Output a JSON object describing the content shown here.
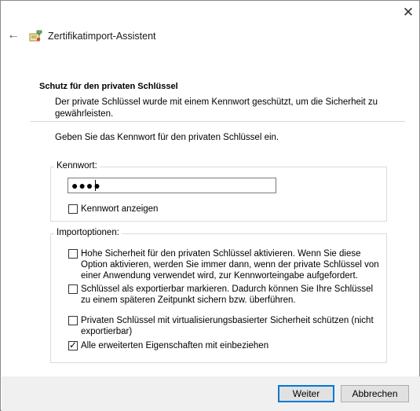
{
  "window": {
    "title": "Zertifikatimport-Assistent",
    "close_glyph": "✕",
    "back_glyph": "←"
  },
  "section": {
    "heading": "Schutz für den privaten Schlüssel",
    "description": "Der private Schlüssel wurde mit einem Kennwort geschützt, um die Sicherheit zu gewährleisten."
  },
  "prompt": "Geben Sie das Kennwort für den privaten Schlüssel ein.",
  "password_group": {
    "label": "Kennwort:",
    "masked_value": "●●●●",
    "show_password_label": "Kennwort anzeigen",
    "show_password_checked": false
  },
  "import_options": {
    "label": "Importoptionen:",
    "options": [
      {
        "label": "Hohe Sicherheit für den privaten Schlüssel aktivieren. Wenn Sie diese Option aktivieren, werden Sie immer dann, wenn der private Schlüssel von einer Anwendung verwendet wird, zur Kennworteingabe aufgefordert.",
        "checked": false
      },
      {
        "label": "Schlüssel als exportierbar markieren. Dadurch können Sie Ihre Schlüssel zu einem späteren Zeitpunkt sichern bzw. überführen.",
        "checked": false
      },
      {
        "label": "Privaten Schlüssel mit virtualisierungsbasierter Sicherheit schützen (nicht exportierbar)",
        "checked": false
      },
      {
        "label": "Alle erweiterten Eigenschaften mit einbeziehen",
        "checked": true
      }
    ]
  },
  "buttons": {
    "next": "Weiter",
    "cancel": "Abbrechen"
  },
  "colors": {
    "accent": "#0078d7",
    "footer_bg": "#f0f0f0"
  }
}
